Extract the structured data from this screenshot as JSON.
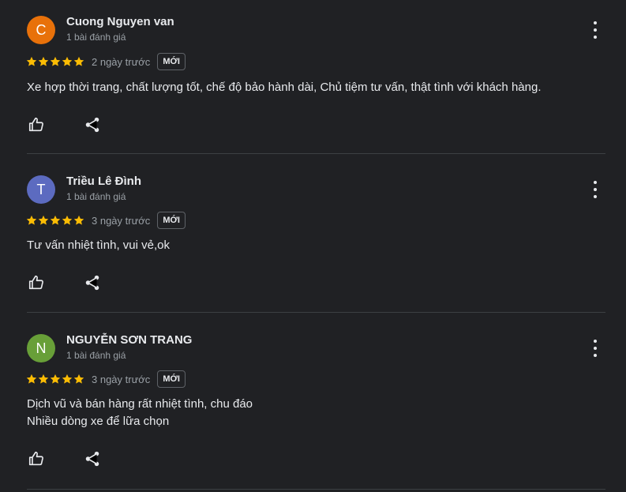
{
  "reviews": [
    {
      "avatar_letter": "C",
      "avatar_color": "#e8710a",
      "name": "Cuong Nguyen van",
      "subtitle": "1 bài đánh giá",
      "rating": 5,
      "time": "2 ngày trước",
      "badge": "MỚI",
      "text": "Xe hợp thời trang, chất lượng tốt, chế độ bảo hành dài, Chủ tiệm tư vấn, thật tình với khách hàng."
    },
    {
      "avatar_letter": "T",
      "avatar_color": "#5c6bc0",
      "name": "Triều Lê Đình",
      "subtitle": "1 bài đánh giá",
      "rating": 5,
      "time": "3 ngày trước",
      "badge": "MỚI",
      "text": "Tư vấn nhiệt tình, vui vẻ,ok"
    },
    {
      "avatar_letter": "N",
      "avatar_color": "#689f38",
      "name": "NGUYỄN SƠN TRANG",
      "subtitle": "1 bài đánh giá",
      "rating": 5,
      "time": "3 ngày trước",
      "badge": "MỚI",
      "text": "Dịch vũ và bán hàng rất nhiệt tình, chu đáo\nNhiều dòng xe để lữa chọn"
    }
  ],
  "colors": {
    "star": "#fbbc04",
    "background": "#202124"
  },
  "icons": {
    "more": "more-vert-icon",
    "like": "thumb-up-icon",
    "share": "share-icon",
    "star": "star-icon"
  }
}
